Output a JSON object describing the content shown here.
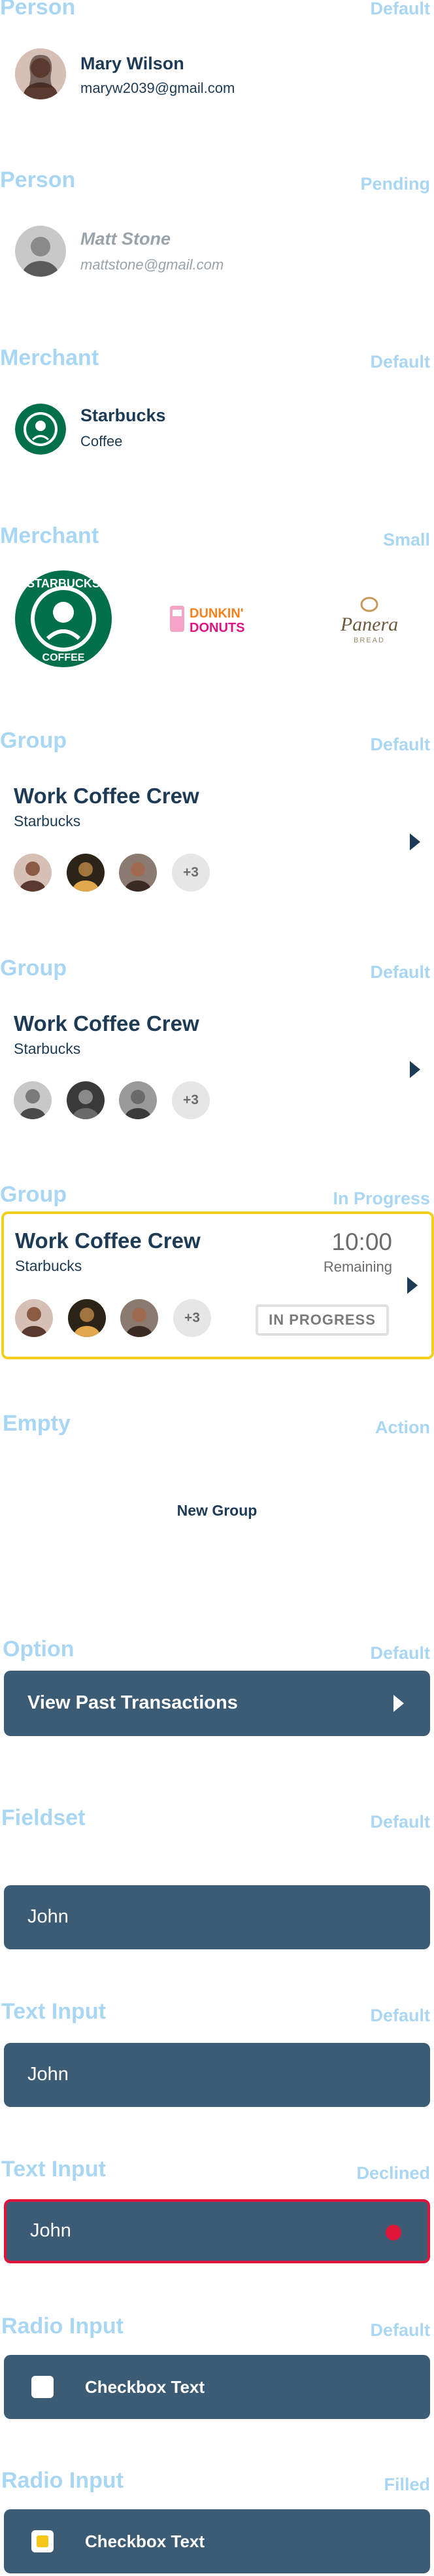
{
  "sections": [
    {
      "title": "Person",
      "variant": "Default"
    },
    {
      "title": "Person",
      "variant": "Pending"
    },
    {
      "title": "Merchant",
      "variant": "Default"
    },
    {
      "title": "Merchant",
      "variant": "Small"
    },
    {
      "title": "Group",
      "variant": "Default"
    },
    {
      "title": "Group",
      "variant": "Default"
    },
    {
      "title": "Group",
      "variant": "In Progress"
    },
    {
      "title": "Empty",
      "variant": "Action"
    },
    {
      "title": "Option",
      "variant": "Default"
    },
    {
      "title": "Fieldset",
      "variant": "Default"
    },
    {
      "title": "Text Input",
      "variant": "Default"
    },
    {
      "title": "Text Input",
      "variant": "Declined"
    },
    {
      "title": "Radio Input",
      "variant": "Default"
    },
    {
      "title": "Radio Input",
      "variant": "Filled"
    }
  ],
  "person_default": {
    "name": "Mary Wilson",
    "email": "maryw2039@gmail.com"
  },
  "person_pending": {
    "name": "Matt Stone",
    "email": "mattstone@gmail.com"
  },
  "merchant_default": {
    "name": "Starbucks",
    "category": "Coffee"
  },
  "merchant_small": {
    "logos": [
      "starbucks-logo",
      "dunkin-donuts-logo",
      "panera-bread-logo"
    ]
  },
  "group1": {
    "name": "Work Coffee Crew",
    "merchant": "Starbucks",
    "extra": "+3"
  },
  "group2": {
    "name": "Work Coffee Crew",
    "merchant": "Starbucks",
    "extra": "+3"
  },
  "group3": {
    "name": "Work Coffee Crew",
    "merchant": "Starbucks",
    "extra": "+3",
    "timer": "10:00",
    "timer_label": "Remaining",
    "status": "IN PROGRESS"
  },
  "empty": {
    "action": "New Group"
  },
  "option": {
    "label": "View Past Transactions"
  },
  "fieldset": {
    "value": "John"
  },
  "text_input_default": {
    "value": "John"
  },
  "text_input_declined": {
    "value": "John"
  },
  "radio_default": {
    "label": "Checkbox Text"
  },
  "radio_filled": {
    "label": "Checkbox Text"
  },
  "colors": {
    "accent_title": "#a9d6f2",
    "dark": "#3c5c76",
    "navy": "#1d3b55",
    "in_progress_border": "#f2cf1d",
    "declined_border": "#e0153a",
    "filled_check": "#f5c518"
  }
}
